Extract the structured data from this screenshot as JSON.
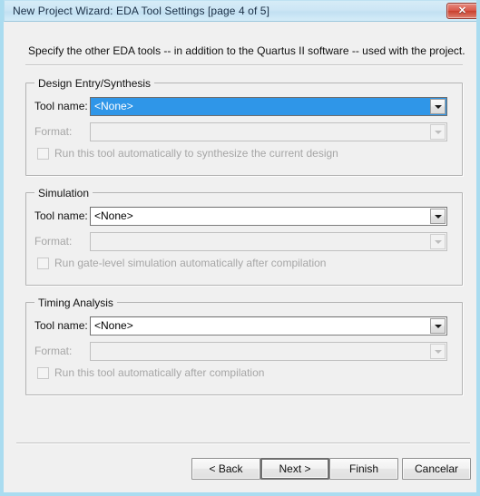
{
  "window": {
    "title": "New Project Wizard: EDA Tool Settings [page 4 of 5]",
    "close_glyph": "✕",
    "accent_title_bg": "#cde6f5",
    "frame_border": "#aadcf0",
    "selection_blue": "#2f96e8",
    "close_red": "#c8412f"
  },
  "intro": {
    "text": "Specify the other EDA tools -- in addition to the Quartus II software -- used with the project."
  },
  "groups": [
    {
      "title": "Design Entry/Synthesis",
      "tool_label": "Tool name:",
      "tool_value": "<None>",
      "tool_state": "selected",
      "format_label": "Format:",
      "format_value": "",
      "format_state": "disabled",
      "checkbox_label": "Run this tool automatically to synthesize the current design",
      "checkbox_checked": false,
      "checkbox_state": "disabled"
    },
    {
      "title": "Simulation",
      "tool_label": "Tool name:",
      "tool_value": "<None>",
      "tool_state": "enabled",
      "format_label": "Format:",
      "format_value": "",
      "format_state": "disabled",
      "checkbox_label": "Run gate-level simulation automatically after compilation",
      "checkbox_checked": false,
      "checkbox_state": "disabled"
    },
    {
      "title": "Timing Analysis",
      "tool_label": "Tool name:",
      "tool_value": "<None>",
      "tool_state": "enabled",
      "format_label": "Format:",
      "format_value": "",
      "format_state": "disabled",
      "checkbox_label": "Run this tool automatically after compilation",
      "checkbox_checked": false,
      "checkbox_state": "disabled"
    }
  ],
  "buttons": {
    "back": "< Back",
    "next": "Next >",
    "finish": "Finish",
    "cancel": "Cancelar",
    "focused": "next"
  }
}
